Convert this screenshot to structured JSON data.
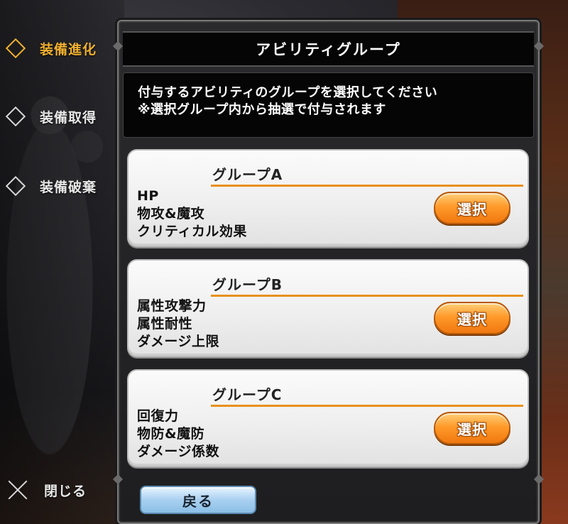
{
  "sidebar": {
    "items": [
      {
        "label": "装備進化",
        "icon": "diamond-icon",
        "active": true
      },
      {
        "label": "装備取得",
        "icon": "diamond-icon",
        "active": false
      },
      {
        "label": "装備破棄",
        "icon": "diamond-icon",
        "active": false
      }
    ],
    "close": {
      "label": "閉じる",
      "icon": "close-icon"
    }
  },
  "dialog": {
    "title": "アビリティグループ",
    "description": [
      "付与するアビリティのグループを選択してください",
      "※選択グループ内から抽選で付与されます"
    ],
    "groups": [
      {
        "title": "グループA",
        "lines": [
          "HP",
          "物攻&魔攻",
          "クリティカル効果"
        ],
        "button": "選択"
      },
      {
        "title": "グループB",
        "lines": [
          "属性攻撃力",
          "属性耐性",
          "ダメージ上限"
        ],
        "button": "選択"
      },
      {
        "title": "グループC",
        "lines": [
          "回復力",
          "物防&魔防",
          "ダメージ係数"
        ],
        "button": "選択"
      }
    ],
    "back_button": "戻る"
  },
  "colors": {
    "accent_orange": "#f0b030",
    "select_button": "#ff9a2a",
    "underline": "#e8901c",
    "back_button": "#a9d0f0"
  }
}
